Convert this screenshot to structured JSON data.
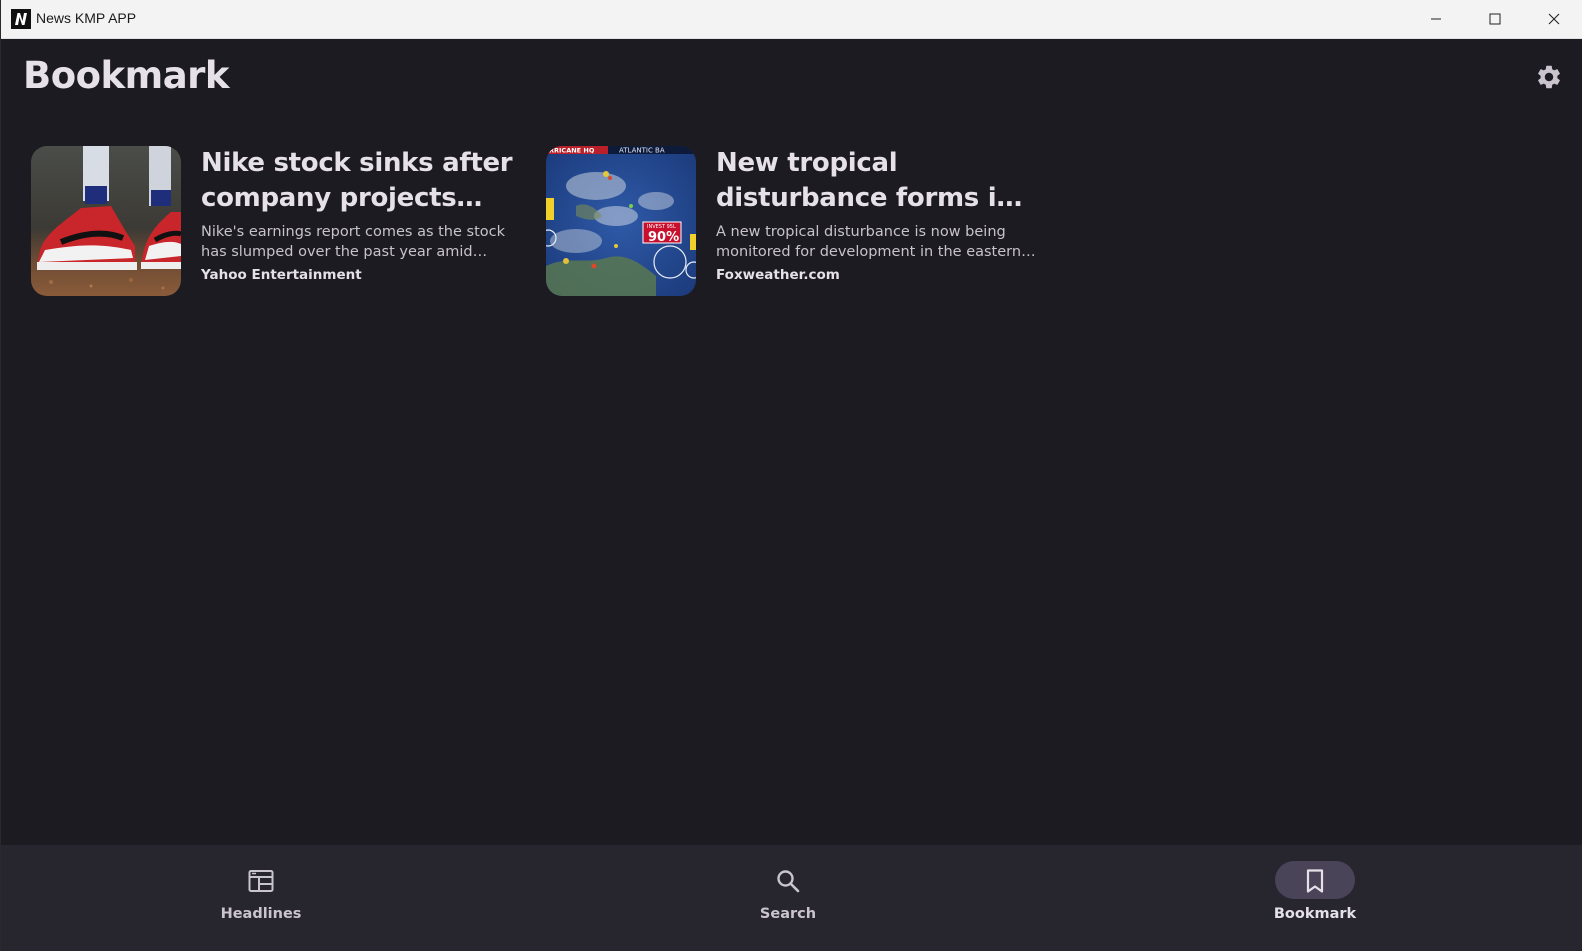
{
  "window": {
    "title": "News KMP APP",
    "controls": [
      "minimize-icon",
      "maximize-icon",
      "close-icon"
    ]
  },
  "header": {
    "title": "Bookmark",
    "settings_icon": "gear-icon"
  },
  "articles": [
    {
      "title": "Nike stock sinks after company projects larg...",
      "description": "Nike's earnings report comes as the stock has slumped over the past year amid slowi...",
      "source": "Yahoo Entertainment",
      "thumbnail": "sneakers-photo"
    },
    {
      "title": "New tropical disturbance forms in ...",
      "description": "A new tropical disturbance is now being monitored for development in the eastern ...",
      "source": "Foxweather.com",
      "thumbnail": "weather-map",
      "thumbnail_text": {
        "banner_left": "RRICANE HQ",
        "banner_right": "ATLANTIC BA",
        "badge_caption": "INVEST 95L",
        "badge_value": "90%"
      }
    }
  ],
  "bottom_nav": {
    "items": [
      {
        "label": "Headlines",
        "icon": "newspaper-icon",
        "active": false
      },
      {
        "label": "Search",
        "icon": "search-icon",
        "active": false
      },
      {
        "label": "Bookmark",
        "icon": "bookmark-icon",
        "active": true
      }
    ]
  },
  "colors": {
    "background": "#1c1b21",
    "nav_background": "#27252d",
    "active_pill": "#4a4458",
    "text_primary": "#e6e1e9"
  }
}
